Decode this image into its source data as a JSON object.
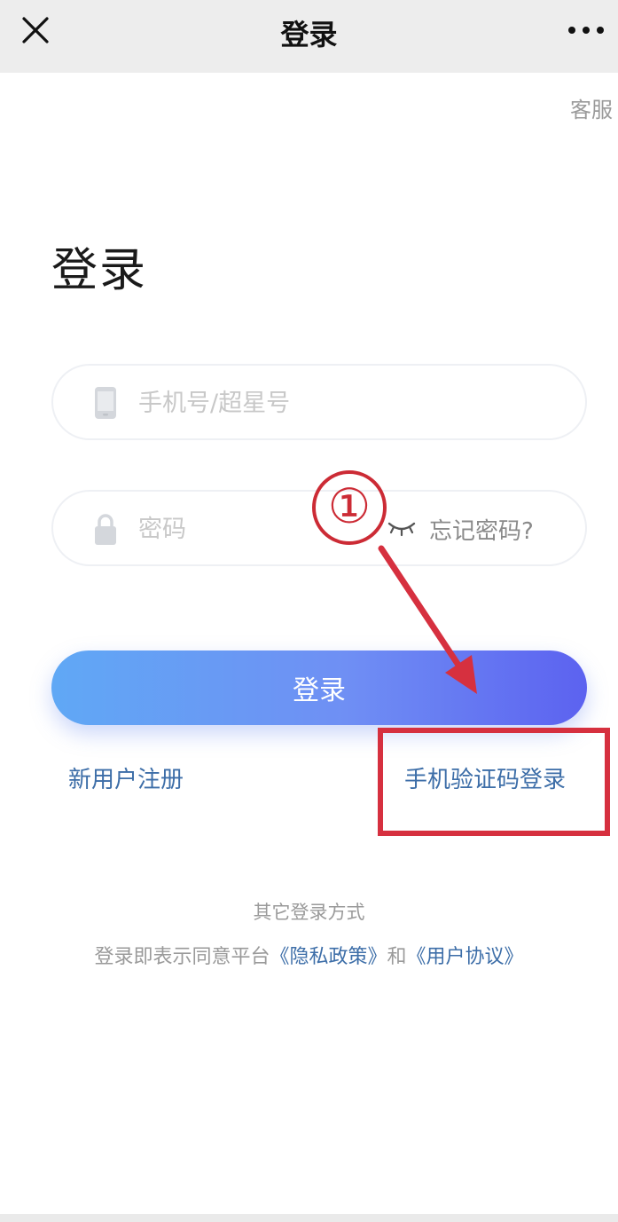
{
  "nav": {
    "title": "登录"
  },
  "header": {
    "service_label": "客服"
  },
  "page": {
    "title": "登录"
  },
  "phone_field": {
    "placeholder": "手机号/超星号"
  },
  "password_field": {
    "placeholder": "密码",
    "forgot_label": "忘记密码?"
  },
  "login_button": {
    "label": "登录"
  },
  "links": {
    "register": "新用户注册",
    "sms_login": "手机验证码登录"
  },
  "other_login": "其它登录方式",
  "agreement": {
    "prefix": "登录即表示同意平台",
    "privacy": "《隐私政策》",
    "and": "和",
    "terms": "《用户协议》"
  },
  "annotation": {
    "number": "①"
  },
  "colors": {
    "accent_link": "#3d6ea8",
    "button_start": "#60a8f5",
    "button_end": "#5c62f0",
    "annotation_red": "#d6303f"
  }
}
